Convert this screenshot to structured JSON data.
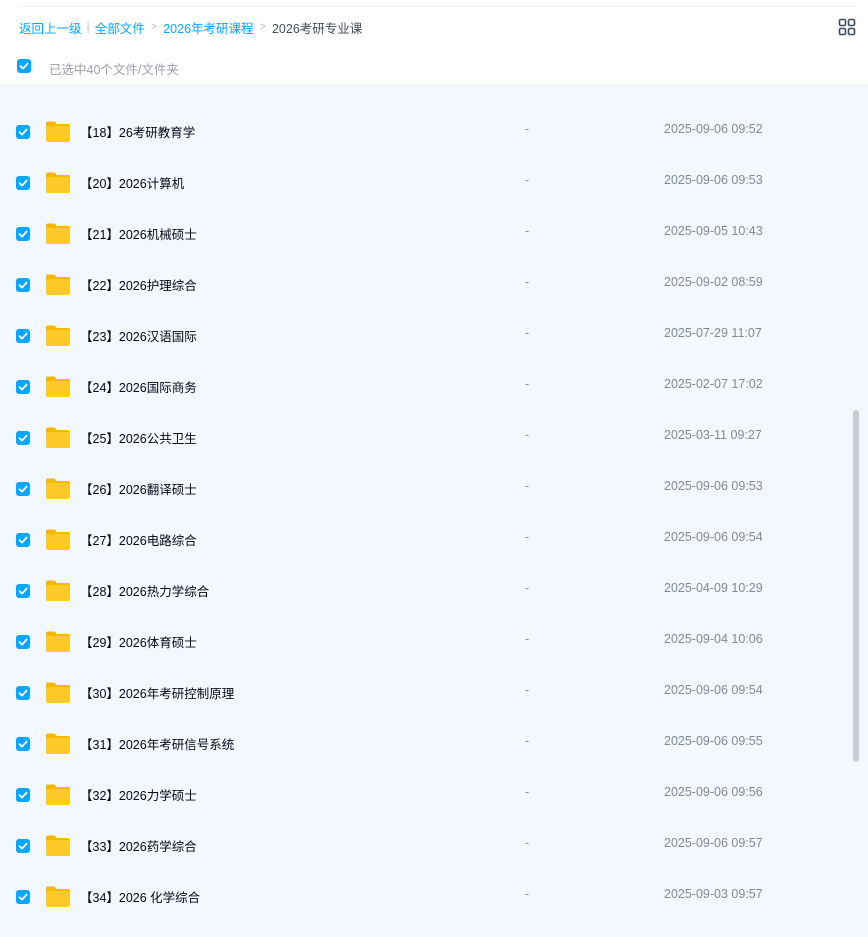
{
  "breadcrumb": {
    "back": "返回上一级",
    "all_files": "全部文件",
    "parent": "2026年考研课程",
    "current": "2026考研专业课",
    "bar": "|",
    "arrow": ">"
  },
  "select_all": {
    "text": "已选中40个文件/文件夹",
    "checked": true
  },
  "colors": {
    "accent": "#06a7ff",
    "folder": "#ffca28",
    "list_bg": "#f2f8fe"
  },
  "icons": {
    "checkbox": "checkbox-checked-icon",
    "folder": "folder-icon",
    "view_toggle": "grid-view-icon"
  },
  "files": [
    {
      "name": "【18】26考研教育学",
      "size": "-",
      "date": "2025-09-06 09:52"
    },
    {
      "name": "【20】2026计算机",
      "size": "-",
      "date": "2025-09-06 09:53"
    },
    {
      "name": "【21】2026机械硕士",
      "size": "-",
      "date": "2025-09-05 10:43"
    },
    {
      "name": "【22】2026护理综合",
      "size": "-",
      "date": "2025-09-02 08:59"
    },
    {
      "name": "【23】2026汉语国际",
      "size": "-",
      "date": "2025-07-29 11:07"
    },
    {
      "name": "【24】2026国际商务",
      "size": "-",
      "date": "2025-02-07 17:02"
    },
    {
      "name": "【25】2026公共卫生",
      "size": "-",
      "date": "2025-03-11 09:27"
    },
    {
      "name": "【26】2026翻译硕士",
      "size": "-",
      "date": "2025-09-06 09:53"
    },
    {
      "name": "【27】2026电路综合",
      "size": "-",
      "date": "2025-09-06 09:54"
    },
    {
      "name": "【28】2026热力学综合",
      "size": "-",
      "date": "2025-04-09 10:29"
    },
    {
      "name": "【29】2026体育硕士",
      "size": "-",
      "date": "2025-09-04 10:06"
    },
    {
      "name": "【30】2026年考研控制原理",
      "size": "-",
      "date": "2025-09-06 09:54"
    },
    {
      "name": "【31】2026年考研信号系统",
      "size": "-",
      "date": "2025-09-06 09:55"
    },
    {
      "name": "【32】2026力学硕士",
      "size": "-",
      "date": "2025-09-06 09:56"
    },
    {
      "name": "【33】2026药学综合",
      "size": "-",
      "date": "2025-09-06 09:57"
    },
    {
      "name": "【34】2026 化学综合",
      "size": "-",
      "date": "2025-09-03 09:57"
    }
  ]
}
